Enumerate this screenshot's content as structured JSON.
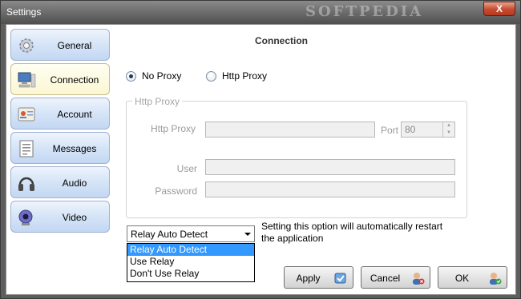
{
  "window": {
    "title": "Settings",
    "watermark": "SOFTPEDIA",
    "close_label": "X"
  },
  "sidebar": {
    "items": [
      {
        "label": "General",
        "icon": "gear-icon",
        "active": false
      },
      {
        "label": "Connection",
        "icon": "computer-icon",
        "active": true
      },
      {
        "label": "Account",
        "icon": "contact-card-icon",
        "active": false
      },
      {
        "label": "Messages",
        "icon": "document-icon",
        "active": false
      },
      {
        "label": "Audio",
        "icon": "headphones-icon",
        "active": false
      },
      {
        "label": "Video",
        "icon": "webcam-icon",
        "active": false
      }
    ]
  },
  "main": {
    "title": "Connection",
    "proxy_options": {
      "no_proxy": {
        "label": "No Proxy",
        "selected": true
      },
      "http_proxy": {
        "label": "Http Proxy",
        "selected": false
      }
    },
    "http_group": {
      "legend": "Http Proxy",
      "http_proxy_label": "Http Proxy",
      "http_proxy_value": "",
      "port_label": "Port",
      "port_value": "80",
      "user_label": "User",
      "user_value": "",
      "password_label": "Password",
      "password_value": ""
    },
    "relay": {
      "selected": "Relay Auto Detect",
      "options": [
        "Relay Auto Detect",
        "Use Relay",
        "Don't Use Relay"
      ],
      "note": "Setting this option will automatically restart the application"
    }
  },
  "footer": {
    "apply_label": "Apply",
    "cancel_label": "Cancel",
    "ok_label": "OK"
  },
  "colors": {
    "accent": "#3399ff",
    "nav_bg": "#d5e4f7",
    "nav_active_bg": "#fbf6d2"
  }
}
